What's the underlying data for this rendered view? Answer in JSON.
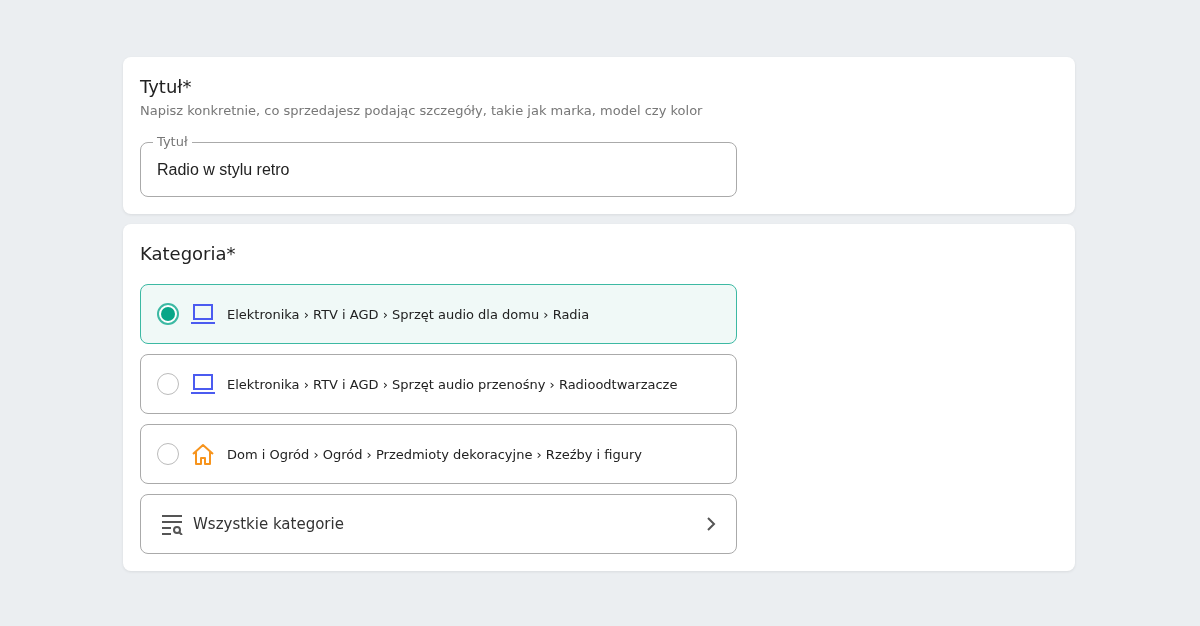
{
  "title_section": {
    "heading": "Tytuł*",
    "hint": "Napisz konkretnie, co sprzedajesz podając szczegóły, takie jak marka, model czy kolor",
    "field": {
      "label": "Tytuł",
      "value": "Radio w stylu retro"
    }
  },
  "category_section": {
    "heading": "Kategoria*",
    "options": [
      {
        "kind": "electronics",
        "path": "Elektronika › RTV i AGD › Sprzęt audio dla domu › Radia",
        "selected": true
      },
      {
        "kind": "electronics",
        "path": "Elektronika › RTV i AGD › Sprzęt audio przenośny › Radioodtwarzacze",
        "selected": false
      },
      {
        "kind": "home",
        "path": "Dom i Ogród › Ogród › Przedmioty dekoracyjne › Rzeźby i figury",
        "selected": false
      }
    ],
    "all_categories": "Wszystkie kategorie"
  }
}
